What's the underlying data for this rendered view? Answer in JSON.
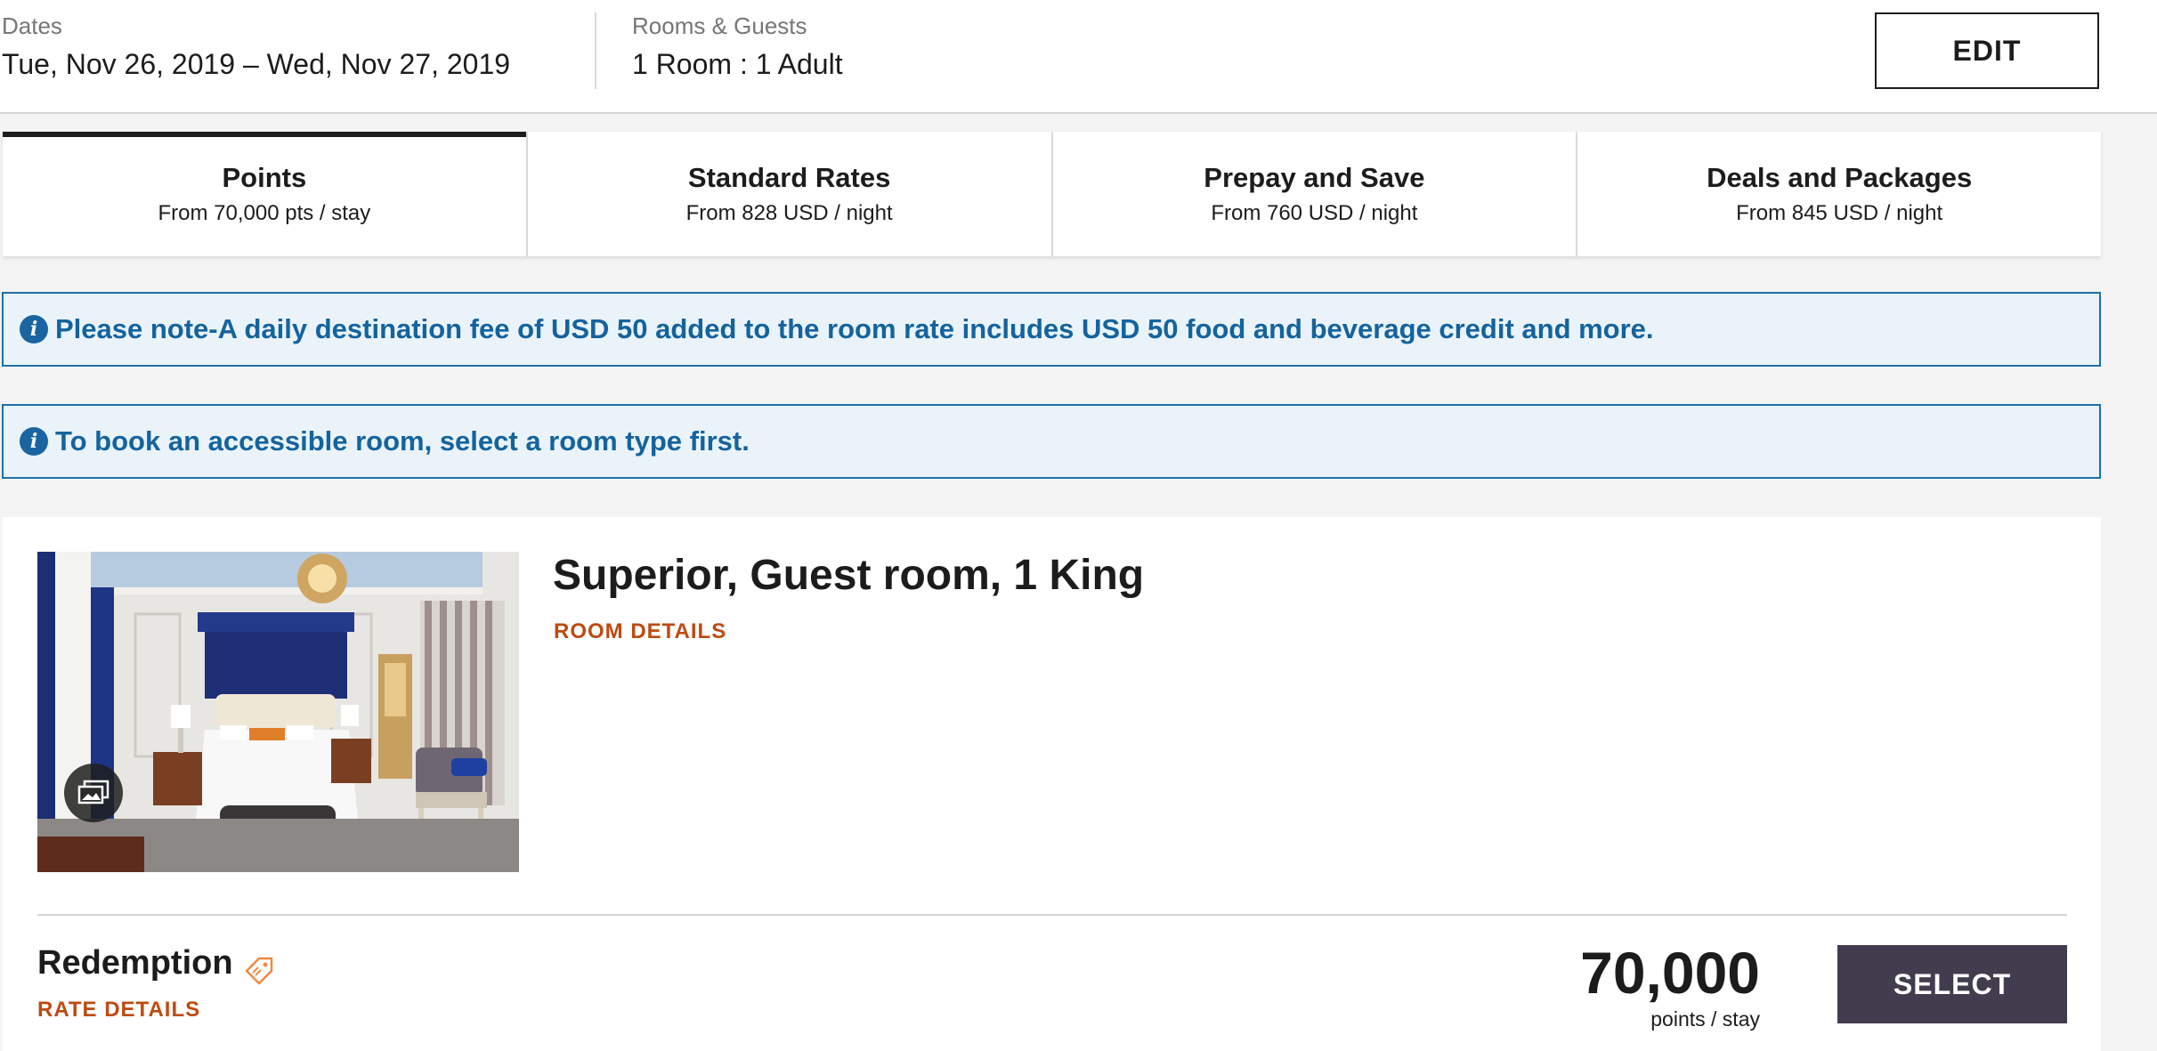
{
  "header": {
    "dates_label": "Dates",
    "dates_value": "Tue, Nov 26, 2019 – Wed, Nov 27, 2019",
    "rooms_label": "Rooms & Guests",
    "rooms_value": "1 Room : 1 Adult",
    "edit_label": "EDIT"
  },
  "tabs": [
    {
      "title": "Points",
      "subtitle": "From 70,000 pts / stay",
      "active": true
    },
    {
      "title": "Standard Rates",
      "subtitle": "From 828 USD / night",
      "active": false
    },
    {
      "title": "Prepay and Save",
      "subtitle": "From 760 USD / night",
      "active": false
    },
    {
      "title": "Deals and Packages",
      "subtitle": "From 845 USD / night",
      "active": false
    }
  ],
  "alerts": [
    {
      "icon": "info-icon",
      "text": "Please note-A daily destination fee of USD 50 added to the room rate includes USD 50 food and beverage credit and more."
    },
    {
      "icon": "info-icon",
      "text": "To book an accessible room, select a room type first."
    }
  ],
  "room": {
    "title": "Superior, Guest room, 1 King",
    "details_link": "ROOM DETAILS",
    "rate": {
      "name": "Redemption",
      "details_link": "RATE DETAILS",
      "price": "70,000",
      "price_unit": "points / stay",
      "select_label": "SELECT"
    }
  },
  "colors": {
    "accent_link": "#bd4b12",
    "info_blue": "#14639e",
    "select_button": "#423d4e"
  }
}
